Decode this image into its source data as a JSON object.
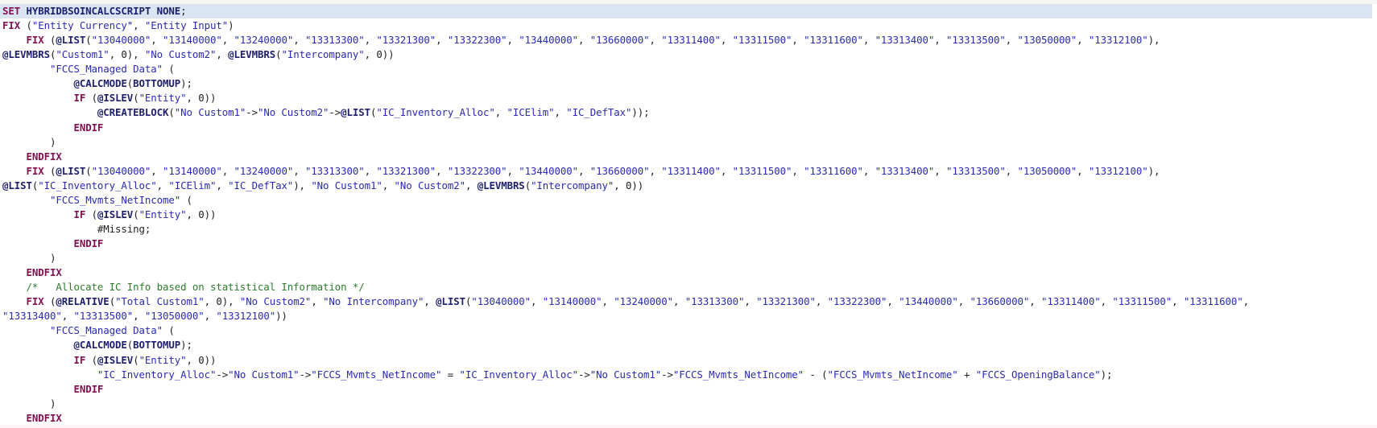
{
  "editor": {
    "language": "Essbase calc script",
    "current_line": 1,
    "colors": {
      "keyword": "#7f0f4f",
      "function": "#1e1e6e",
      "string": "#2a2ab4",
      "comment": "#2b7a2b",
      "current_line_highlight": "#dae5f4"
    },
    "lines": [
      [
        [
          "kw",
          "SET "
        ],
        [
          "fn",
          "HYBRIDBSOINCALCSCRIPT NONE"
        ],
        [
          "op",
          ";"
        ]
      ],
      [
        [
          "kw",
          "FIX "
        ],
        [
          "op",
          "("
        ],
        [
          "str",
          "\"Entity Currency\""
        ],
        [
          "op",
          ", "
        ],
        [
          "str",
          "\"Entity Input\""
        ],
        [
          "op",
          ")"
        ]
      ],
      [
        [
          "op",
          "    "
        ],
        [
          "kw",
          "FIX "
        ],
        [
          "op",
          "("
        ],
        [
          "fn",
          "@LIST"
        ],
        [
          "op",
          "("
        ],
        [
          "str",
          "\"13040000\""
        ],
        [
          "op",
          ", "
        ],
        [
          "str",
          "\"13140000\""
        ],
        [
          "op",
          ", "
        ],
        [
          "str",
          "\"13240000\""
        ],
        [
          "op",
          ", "
        ],
        [
          "str",
          "\"13313300\""
        ],
        [
          "op",
          ", "
        ],
        [
          "str",
          "\"13321300\""
        ],
        [
          "op",
          ", "
        ],
        [
          "str",
          "\"13322300\""
        ],
        [
          "op",
          ", "
        ],
        [
          "str",
          "\"13440000\""
        ],
        [
          "op",
          ", "
        ],
        [
          "str",
          "\"13660000\""
        ],
        [
          "op",
          ", "
        ],
        [
          "str",
          "\"13311400\""
        ],
        [
          "op",
          ", "
        ],
        [
          "str",
          "\"13311500\""
        ],
        [
          "op",
          ", "
        ],
        [
          "str",
          "\"13311600\""
        ],
        [
          "op",
          ", "
        ],
        [
          "str",
          "\"13313400\""
        ],
        [
          "op",
          ", "
        ],
        [
          "str",
          "\"13313500\""
        ],
        [
          "op",
          ", "
        ],
        [
          "str",
          "\"13050000\""
        ],
        [
          "op",
          ", "
        ],
        [
          "str",
          "\"13312100\""
        ],
        [
          "op",
          "),"
        ]
      ],
      [
        [
          "fn",
          "@LEVMBRS"
        ],
        [
          "op",
          "("
        ],
        [
          "str",
          "\"Custom1\""
        ],
        [
          "op",
          ", 0), "
        ],
        [
          "str",
          "\"No Custom2\""
        ],
        [
          "op",
          ", "
        ],
        [
          "fn",
          "@LEVMBRS"
        ],
        [
          "op",
          "("
        ],
        [
          "str",
          "\"Intercompany\""
        ],
        [
          "op",
          ", 0))"
        ]
      ],
      [
        [
          "op",
          "        "
        ],
        [
          "str",
          "\"FCCS_Managed Data\""
        ],
        [
          "op",
          " ("
        ]
      ],
      [
        [
          "op",
          "            "
        ],
        [
          "fn",
          "@CALCMODE"
        ],
        [
          "op",
          "("
        ],
        [
          "fn",
          "BOTTOMUP"
        ],
        [
          "op",
          ");"
        ]
      ],
      [
        [
          "op",
          "            "
        ],
        [
          "kw",
          "IF "
        ],
        [
          "op",
          "("
        ],
        [
          "fn",
          "@ISLEV"
        ],
        [
          "op",
          "("
        ],
        [
          "str",
          "\"Entity\""
        ],
        [
          "op",
          ", 0))"
        ]
      ],
      [
        [
          "op",
          "                "
        ],
        [
          "fn",
          "@CREATEBLOCK"
        ],
        [
          "op",
          "("
        ],
        [
          "str",
          "\"No Custom1\""
        ],
        [
          "op",
          "->"
        ],
        [
          "str",
          "\"No Custom2\""
        ],
        [
          "op",
          "->"
        ],
        [
          "fn",
          "@LIST"
        ],
        [
          "op",
          "("
        ],
        [
          "str",
          "\"IC_Inventory_Alloc\""
        ],
        [
          "op",
          ", "
        ],
        [
          "str",
          "\"ICElim\""
        ],
        [
          "op",
          ", "
        ],
        [
          "str",
          "\"IC_DefTax\""
        ],
        [
          "op",
          "));"
        ]
      ],
      [
        [
          "op",
          "            "
        ],
        [
          "kw",
          "ENDIF"
        ]
      ],
      [
        [
          "op",
          "        )"
        ]
      ],
      [
        [
          "op",
          "    "
        ],
        [
          "kw",
          "ENDFIX"
        ]
      ],
      [
        [
          "op",
          "    "
        ],
        [
          "kw",
          "FIX "
        ],
        [
          "op",
          "("
        ],
        [
          "fn",
          "@LIST"
        ],
        [
          "op",
          "("
        ],
        [
          "str",
          "\"13040000\""
        ],
        [
          "op",
          ", "
        ],
        [
          "str",
          "\"13140000\""
        ],
        [
          "op",
          ", "
        ],
        [
          "str",
          "\"13240000\""
        ],
        [
          "op",
          ", "
        ],
        [
          "str",
          "\"13313300\""
        ],
        [
          "op",
          ", "
        ],
        [
          "str",
          "\"13321300\""
        ],
        [
          "op",
          ", "
        ],
        [
          "str",
          "\"13322300\""
        ],
        [
          "op",
          ", "
        ],
        [
          "str",
          "\"13440000\""
        ],
        [
          "op",
          ", "
        ],
        [
          "str",
          "\"13660000\""
        ],
        [
          "op",
          ", "
        ],
        [
          "str",
          "\"13311400\""
        ],
        [
          "op",
          ", "
        ],
        [
          "str",
          "\"13311500\""
        ],
        [
          "op",
          ", "
        ],
        [
          "str",
          "\"13311600\""
        ],
        [
          "op",
          ", "
        ],
        [
          "str",
          "\"13313400\""
        ],
        [
          "op",
          ", "
        ],
        [
          "str",
          "\"13313500\""
        ],
        [
          "op",
          ", "
        ],
        [
          "str",
          "\"13050000\""
        ],
        [
          "op",
          ", "
        ],
        [
          "str",
          "\"13312100\""
        ],
        [
          "op",
          "),"
        ]
      ],
      [
        [
          "fn",
          "@LIST"
        ],
        [
          "op",
          "("
        ],
        [
          "str",
          "\"IC_Inventory_Alloc\""
        ],
        [
          "op",
          ", "
        ],
        [
          "str",
          "\"ICElim\""
        ],
        [
          "op",
          ", "
        ],
        [
          "str",
          "\"IC_DefTax\""
        ],
        [
          "op",
          "), "
        ],
        [
          "str",
          "\"No Custom1\""
        ],
        [
          "op",
          ", "
        ],
        [
          "str",
          "\"No Custom2\""
        ],
        [
          "op",
          ", "
        ],
        [
          "fn",
          "@LEVMBRS"
        ],
        [
          "op",
          "("
        ],
        [
          "str",
          "\"Intercompany\""
        ],
        [
          "op",
          ", 0))"
        ]
      ],
      [
        [
          "op",
          "        "
        ],
        [
          "str",
          "\"FCCS_Mvmts_NetIncome\""
        ],
        [
          "op",
          " ("
        ]
      ],
      [
        [
          "op",
          "            "
        ],
        [
          "kw",
          "IF "
        ],
        [
          "op",
          "("
        ],
        [
          "fn",
          "@ISLEV"
        ],
        [
          "op",
          "("
        ],
        [
          "str",
          "\"Entity\""
        ],
        [
          "op",
          ", 0))"
        ]
      ],
      [
        [
          "op",
          "                #Missing;"
        ]
      ],
      [
        [
          "op",
          "            "
        ],
        [
          "kw",
          "ENDIF"
        ]
      ],
      [
        [
          "op",
          "        )"
        ]
      ],
      [
        [
          "op",
          "    "
        ],
        [
          "kw",
          "ENDFIX"
        ]
      ],
      [
        [
          "op",
          "    "
        ],
        [
          "cm",
          "/*   Allocate IC Info based on statistical Information */"
        ]
      ],
      [
        [
          "op",
          "    "
        ],
        [
          "kw",
          "FIX "
        ],
        [
          "op",
          "("
        ],
        [
          "fn",
          "@RELATIVE"
        ],
        [
          "op",
          "("
        ],
        [
          "str",
          "\"Total Custom1\""
        ],
        [
          "op",
          ", 0), "
        ],
        [
          "str",
          "\"No Custom2\""
        ],
        [
          "op",
          ", "
        ],
        [
          "str",
          "\"No Intercompany\""
        ],
        [
          "op",
          ", "
        ],
        [
          "fn",
          "@LIST"
        ],
        [
          "op",
          "("
        ],
        [
          "str",
          "\"13040000\""
        ],
        [
          "op",
          ", "
        ],
        [
          "str",
          "\"13140000\""
        ],
        [
          "op",
          ", "
        ],
        [
          "str",
          "\"13240000\""
        ],
        [
          "op",
          ", "
        ],
        [
          "str",
          "\"13313300\""
        ],
        [
          "op",
          ", "
        ],
        [
          "str",
          "\"13321300\""
        ],
        [
          "op",
          ", "
        ],
        [
          "str",
          "\"13322300\""
        ],
        [
          "op",
          ", "
        ],
        [
          "str",
          "\"13440000\""
        ],
        [
          "op",
          ", "
        ],
        [
          "str",
          "\"13660000\""
        ],
        [
          "op",
          ", "
        ],
        [
          "str",
          "\"13311400\""
        ],
        [
          "op",
          ", "
        ],
        [
          "str",
          "\"13311500\""
        ],
        [
          "op",
          ", "
        ],
        [
          "str",
          "\"13311600\""
        ],
        [
          "op",
          ","
        ]
      ],
      [
        [
          "str",
          "\"13313400\""
        ],
        [
          "op",
          ", "
        ],
        [
          "str",
          "\"13313500\""
        ],
        [
          "op",
          ", "
        ],
        [
          "str",
          "\"13050000\""
        ],
        [
          "op",
          ", "
        ],
        [
          "str",
          "\"13312100\""
        ],
        [
          "op",
          "))"
        ]
      ],
      [
        [
          "op",
          "        "
        ],
        [
          "str",
          "\"FCCS_Managed Data\""
        ],
        [
          "op",
          " ("
        ]
      ],
      [
        [
          "op",
          "            "
        ],
        [
          "fn",
          "@CALCMODE"
        ],
        [
          "op",
          "("
        ],
        [
          "fn",
          "BOTTOMUP"
        ],
        [
          "op",
          ");"
        ]
      ],
      [
        [
          "op",
          "            "
        ],
        [
          "kw",
          "IF "
        ],
        [
          "op",
          "("
        ],
        [
          "fn",
          "@ISLEV"
        ],
        [
          "op",
          "("
        ],
        [
          "str",
          "\"Entity\""
        ],
        [
          "op",
          ", 0))"
        ]
      ],
      [
        [
          "op",
          "                "
        ],
        [
          "str",
          "\"IC_Inventory_Alloc\""
        ],
        [
          "op",
          "->"
        ],
        [
          "str",
          "\"No Custom1\""
        ],
        [
          "op",
          "->"
        ],
        [
          "str",
          "\"FCCS_Mvmts_NetIncome\""
        ],
        [
          "op",
          " = "
        ],
        [
          "str",
          "\"IC_Inventory_Alloc\""
        ],
        [
          "op",
          "->"
        ],
        [
          "str",
          "\"No Custom1\""
        ],
        [
          "op",
          "->"
        ],
        [
          "str",
          "\"FCCS_Mvmts_NetIncome\""
        ],
        [
          "op",
          " - ("
        ],
        [
          "str",
          "\"FCCS_Mvmts_NetIncome\""
        ],
        [
          "op",
          " + "
        ],
        [
          "str",
          "\"FCCS_OpeningBalance\""
        ],
        [
          "op",
          ");"
        ]
      ],
      [
        [
          "op",
          "            "
        ],
        [
          "kw",
          "ENDIF"
        ]
      ],
      [
        [
          "op",
          "        )"
        ]
      ],
      [
        [
          "op",
          "    "
        ],
        [
          "kw",
          "ENDFIX"
        ]
      ]
    ]
  }
}
